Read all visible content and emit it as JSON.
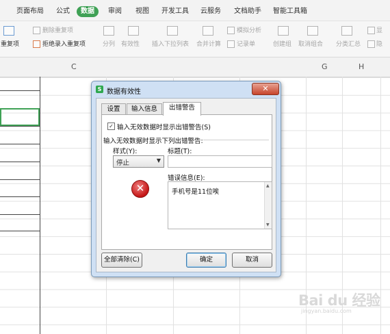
{
  "menu": {
    "items": [
      {
        "label": "页面布局"
      },
      {
        "label": "公式"
      },
      {
        "label": "数据",
        "active": true
      },
      {
        "label": "审阅"
      },
      {
        "label": "视图"
      },
      {
        "label": "开发工具"
      },
      {
        "label": "云服务"
      },
      {
        "label": "文档助手"
      },
      {
        "label": "智能工具箱"
      }
    ]
  },
  "ribbon": {
    "remove_duplicates": "删除重复项",
    "duplicates_dropdown": "重复项",
    "reject_duplicates": "拒绝录入重复项",
    "split": "分列",
    "validity": "有效性",
    "insert_dropdown_list": "插入下拉列表",
    "merge_calc": "合并计算",
    "simulation": "模拟分析",
    "record_form": "记录单",
    "create_group": "创建组",
    "ungroup": "取消组合",
    "subtotal": "分类汇总",
    "show_detail": "显",
    "hide_detail": "隐"
  },
  "sheet": {
    "columns": [
      "C",
      "G",
      "H"
    ]
  },
  "dialog": {
    "title": "数据有效性",
    "app_icon": "S",
    "close_glyph": "✕",
    "tabs": [
      "设置",
      "输入信息",
      "出错警告"
    ],
    "active_tab": 2,
    "show_error_checkbox": {
      "checked": true,
      "label": "输入无效数据时显示出错警告(S)",
      "mark": "✓"
    },
    "section_label": "输入无效数据时显示下列出错警告:",
    "style_label": "样式(Y):",
    "style_value": "停止",
    "style_arrow": "▼",
    "style_icon": "error-stop-icon",
    "error_glyph": "✕",
    "title_label": "标题(T):",
    "title_value": "",
    "error_message_label": "错误信息(E):",
    "error_message_value": "手机号是11位唉",
    "buttons": {
      "clear_all": "全部清除(C)",
      "ok": "确定",
      "cancel": "取消"
    }
  },
  "watermark": {
    "logo": "Bai du 经验",
    "url": "jingyan.baidu.com"
  },
  "colors": {
    "accent": "#3fa155",
    "dialog_frame": "#cfe0f4",
    "close_button": "#c7442b",
    "error_icon": "#c51616"
  }
}
